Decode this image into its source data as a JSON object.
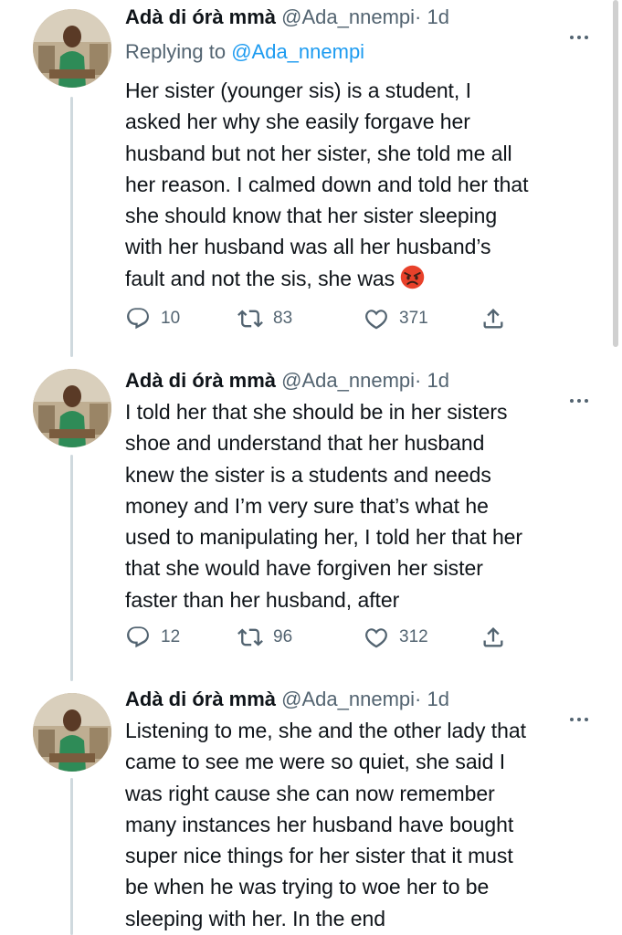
{
  "tweets": [
    {
      "name": "Adà di órà mmà",
      "handle": "@Ada_nnempi",
      "sep": "·",
      "time": "1d",
      "replying_label": "Replying to",
      "replying_to": "@Ada_nnempi",
      "text": "Her sister (younger sis) is a student, I\nasked her why she easily forgave her\nhusband but not her sister, she told me all\nher reason. I calmed down and told her that\nshe should know that her sister sleeping\nwith her husband was all her husband’s\nfault and not the sis, she was",
      "emoji": "angry-face",
      "replies": "10",
      "retweets": "83",
      "likes": "371"
    },
    {
      "name": "Adà di órà mmà",
      "handle": "@Ada_nnempi",
      "sep": "·",
      "time": "1d",
      "text": "I told her that she should be in her sisters\nshoe and understand that her husband\nknew the sister is a students and needs\nmoney and I’m very sure that’s what he\nused to manipulating her, I told her that her\nthat she would have forgiven her sister\nfaster than her husband, after",
      "replies": "12",
      "retweets": "96",
      "likes": "312"
    },
    {
      "name": "Adà di órà mmà",
      "handle": "@Ada_nnempi",
      "sep": "·",
      "time": "1d",
      "text": "Listening to me, she and the other lady that\ncame to see me were so quiet, she said I\nwas right cause she can now remember\nmany instances her husband have bought\nsuper nice things for her sister that it must\nbe when he was trying to woe her to be\nsleeping with her. In the end"
    }
  ],
  "colors": {
    "text": "#0f1419",
    "secondary": "#536471",
    "link": "#1d9bf0",
    "thread_line": "#cfd9de"
  },
  "icons": [
    "reply-icon",
    "retweet-icon",
    "like-icon",
    "share-icon",
    "more-icon",
    "angry-face-emoji"
  ]
}
